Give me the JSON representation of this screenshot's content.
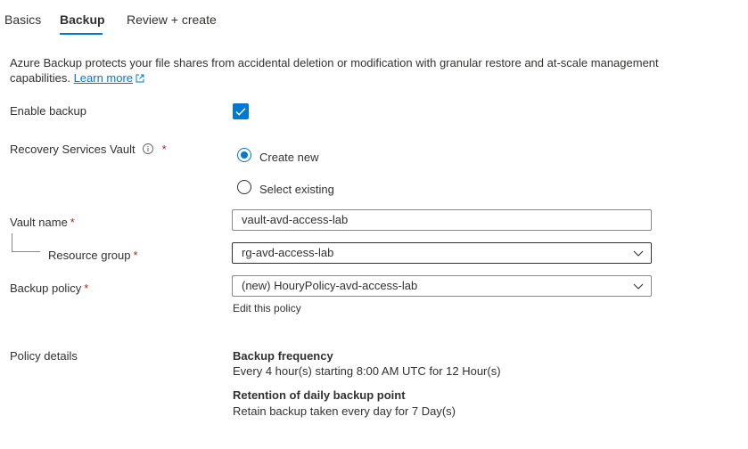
{
  "tabs": [
    {
      "label": "Basics"
    },
    {
      "label": "Backup"
    },
    {
      "label": "Review + create"
    }
  ],
  "description": {
    "text": "Azure Backup protects your file shares from accidental deletion or modification with granular restore and at-scale management capabilities.",
    "learn_more": "Learn more"
  },
  "enable_backup": {
    "label": "Enable backup",
    "checked": true
  },
  "recovery_vault": {
    "label": "Recovery Services Vault",
    "required_mark": "*",
    "options": [
      {
        "label": "Create new",
        "selected": true
      },
      {
        "label": "Select existing",
        "selected": false
      }
    ]
  },
  "vault_name": {
    "label": "Vault name",
    "required_mark": "*",
    "value": "vault-avd-access-lab"
  },
  "resource_group": {
    "label": "Resource group",
    "required_mark": "*",
    "value": "rg-avd-access-lab"
  },
  "backup_policy": {
    "label": "Backup policy",
    "required_mark": "*",
    "value": "(new) HouryPolicy-avd-access-lab",
    "edit_link": "Edit this policy"
  },
  "policy_details": {
    "label": "Policy details",
    "frequency_title": "Backup frequency",
    "frequency_text": "Every 4 hour(s) starting 8:00 AM UTC for 12 Hour(s)",
    "retention_title": "Retention of daily backup point",
    "retention_text": "Retain backup taken every day for 7 Day(s)"
  },
  "colors": {
    "accent": "#0078d4",
    "required": "#a4262c",
    "text": "#323130"
  }
}
